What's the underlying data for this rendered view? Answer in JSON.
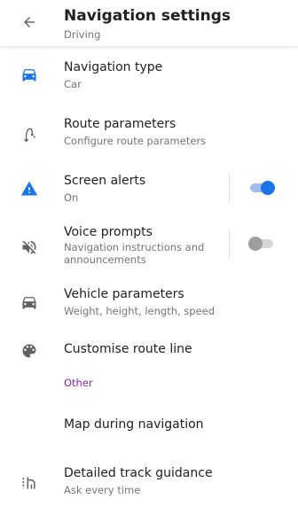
{
  "header": {
    "title": "Navigation settings",
    "subtitle": "Driving"
  },
  "items": [
    {
      "title": "Navigation type",
      "subtitle": "Car",
      "icon": "car-icon",
      "icon_color": "#1a73e8"
    },
    {
      "title": "Route parameters",
      "subtitle": "Configure route parameters",
      "icon": "route-icon"
    },
    {
      "title": "Screen alerts",
      "subtitle": "On",
      "icon": "warning-icon",
      "icon_color": "#1a73e8",
      "toggle_on": true
    },
    {
      "title": "Voice prompts",
      "subtitle": "Navigation instructions and announcements",
      "icon": "volume-off-icon",
      "toggle_on": false
    },
    {
      "title": "Vehicle parameters",
      "subtitle": "Weight, height, length, speed",
      "icon": "car-icon"
    },
    {
      "title": "Customise route line",
      "icon": "palette-icon"
    }
  ],
  "section": {
    "label": "Other",
    "color": "#8e24aa"
  },
  "other_items": [
    {
      "title": "Map during navigation"
    },
    {
      "title": "Detailed track guidance",
      "subtitle": "Ask every time",
      "icon": "track-guidance-icon"
    }
  ],
  "colors": {
    "accent": "#1a73e8",
    "icon_gray": "#616161"
  }
}
